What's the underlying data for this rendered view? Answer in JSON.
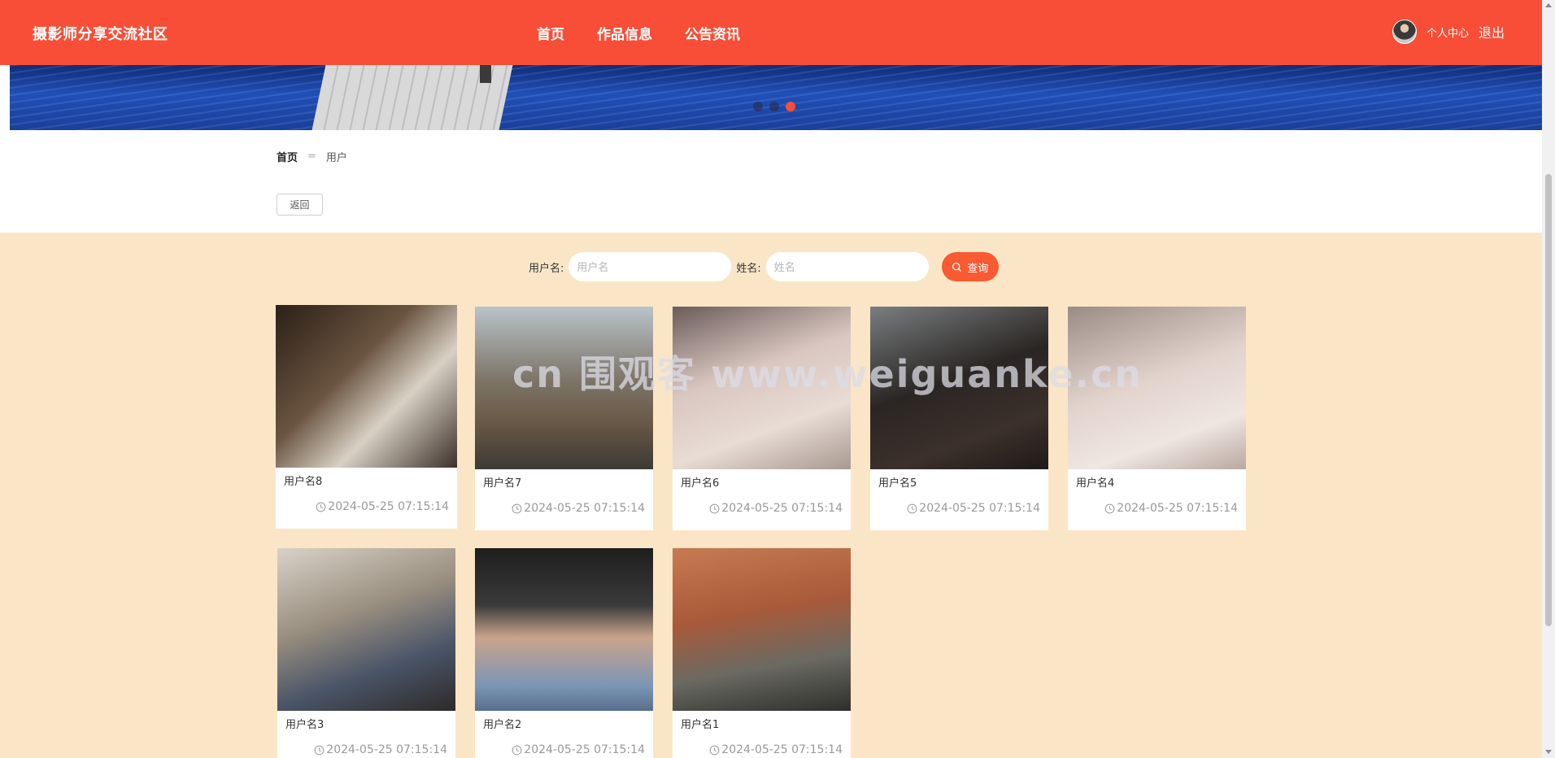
{
  "header": {
    "brand": "摄影师分享交流社区",
    "nav": [
      "首页",
      "作品信息",
      "公告资讯"
    ],
    "user_center": "个人中心",
    "logout": "退出"
  },
  "banner": {
    "slide_count": 3,
    "active_slide": 3
  },
  "breadcrumb": {
    "home": "首页",
    "separator": "=",
    "current": "用户"
  },
  "back_button": "返回",
  "search": {
    "username_label": "用户名:",
    "username_placeholder": "用户名",
    "name_label": "姓名:",
    "name_placeholder": "姓名",
    "button_label": "查询"
  },
  "users": [
    {
      "name": "用户名8",
      "time": "2024-05-25 07:15:14"
    },
    {
      "name": "用户名7",
      "time": "2024-05-25 07:15:14"
    },
    {
      "name": "用户名6",
      "time": "2024-05-25 07:15:14"
    },
    {
      "name": "用户名5",
      "time": "2024-05-25 07:15:14"
    },
    {
      "name": "用户名4",
      "time": "2024-05-25 07:15:14"
    },
    {
      "name": "用户名3",
      "time": "2024-05-25 07:15:14"
    },
    {
      "name": "用户名2",
      "time": "2024-05-25 07:15:14"
    },
    {
      "name": "用户名1",
      "time": "2024-05-25 07:15:14"
    }
  ],
  "watermark": "cn 围观客 www.weiguanke.cn",
  "colors": {
    "header": "#f84e37",
    "content_bg": "#fae6c7",
    "accent": "#f85a32"
  }
}
